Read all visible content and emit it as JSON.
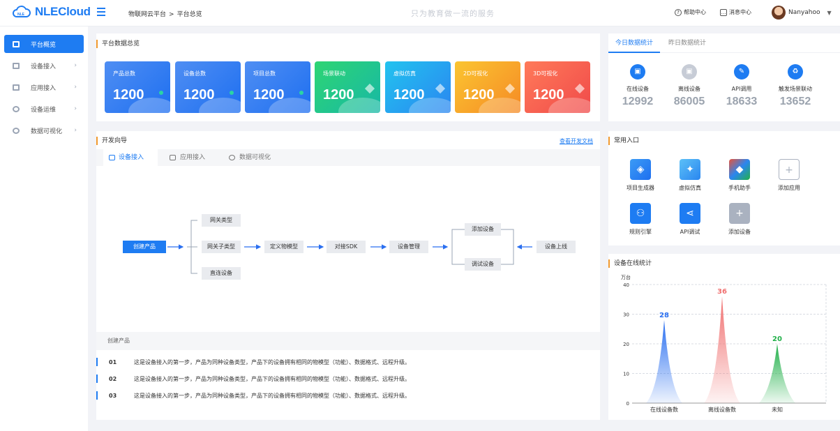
{
  "header": {
    "logo_text": "NLECloud",
    "breadcrumb": [
      "物联网云平台",
      "平台总览"
    ],
    "breadcrumb_sep": ">",
    "slogan": "只为教育做一流的服务",
    "help_label": "帮助中心",
    "message_label": "消息中心",
    "username": "Nanyahoo"
  },
  "sidebar": {
    "items": [
      {
        "label": "平台概览",
        "active": true
      },
      {
        "label": "设备接入"
      },
      {
        "label": "应用接入"
      },
      {
        "label": "设备运维"
      },
      {
        "label": "数据可视化"
      }
    ]
  },
  "overview": {
    "title": "平台数据总览",
    "tiles": [
      {
        "label": "产品总数",
        "value": "1200",
        "colors": [
          "#4f8ef3",
          "#1e6ff0"
        ]
      },
      {
        "label": "设备总数",
        "value": "1200",
        "colors": [
          "#4f8ef3",
          "#1e6ff0"
        ]
      },
      {
        "label": "项目总数",
        "value": "1200",
        "colors": [
          "#4f8ef3",
          "#1e6ff0"
        ]
      },
      {
        "label": "场景联动",
        "value": "1200",
        "colors": [
          "#2ed573",
          "#17b8a6"
        ]
      },
      {
        "label": "虚拟仿真",
        "value": "1200",
        "colors": [
          "#22c3ef",
          "#2a86f0"
        ]
      },
      {
        "label": "2D可视化",
        "value": "1200",
        "colors": [
          "#fbc531",
          "#f58a25"
        ]
      },
      {
        "label": "3D可视化",
        "value": "1200",
        "colors": [
          "#ff7a59",
          "#f04a4a"
        ]
      }
    ]
  },
  "today": {
    "tabs": [
      "今日数据统计",
      "昨日数据统计"
    ],
    "stats": [
      {
        "label": "在线设备",
        "value": "12992",
        "icon": "monitor-icon"
      },
      {
        "label": "离线设备",
        "value": "86005",
        "icon": "monitor-off-icon"
      },
      {
        "label": "API调用",
        "value": "18633",
        "icon": "api-icon"
      },
      {
        "label": "触发场景联动",
        "value": "13652",
        "icon": "recycle-icon"
      }
    ]
  },
  "guide": {
    "title": "开发向导",
    "doc_link": "查看开发文档",
    "tabs": [
      "设备接入",
      "应用接入",
      "数据可视化"
    ],
    "flow": {
      "create": "创建产品",
      "gateway": "网关类型",
      "gateway_sub": "网关子类型",
      "direct": "直连设备",
      "model": "定义物模型",
      "sdk": "对接SDK",
      "manage": "设备管理",
      "add": "添加设备",
      "debug": "调试设备",
      "online": "设备上线"
    },
    "steps_title": "创建产品",
    "steps": [
      {
        "num": "01",
        "text": "这是设备接入的第一步，产品为同种设备类型，产品下的设备拥有相同的物模型（功能）、数据格式、远程升级。"
      },
      {
        "num": "02",
        "text": "这是设备接入的第一步，产品为同种设备类型，产品下的设备拥有相同的物模型（功能）、数据格式、远程升级。"
      },
      {
        "num": "03",
        "text": "这是设备接入的第一步，产品为同种设备类型，产品下的设备拥有相同的物模型（功能）、数据格式、远程升级。"
      }
    ]
  },
  "entries": {
    "title": "常用入口",
    "items": [
      {
        "label": "项目生成器",
        "icon": "cube-icon",
        "color": "#1e7cf2"
      },
      {
        "label": "虚拟仿真",
        "icon": "network-icon",
        "color": "#2a9df4"
      },
      {
        "label": "手机助手",
        "icon": "gem-icon",
        "color": "#e8543b"
      },
      {
        "label": "添加应用",
        "icon": "plus-icon",
        "color": "#ffffff"
      },
      {
        "label": "规则引擎",
        "icon": "nodes-icon",
        "color": "#1e7cf2"
      },
      {
        "label": "API调试",
        "icon": "share-icon",
        "color": "#1e7cf2"
      },
      {
        "label": "添加设备",
        "icon": "plus-icon",
        "color": "#aab2c0"
      }
    ]
  },
  "online_chart": {
    "title": "设备在线统计",
    "unit": "万台"
  },
  "chart_data": {
    "type": "bar",
    "categories": [
      "在线设备数",
      "离线设备数",
      "未知"
    ],
    "values": [
      28,
      36,
      20
    ],
    "ylim": [
      0,
      40
    ],
    "yticks": [
      "0",
      "10",
      "20",
      "30",
      "40"
    ],
    "colors": [
      "#2a6ff0",
      "#f07070",
      "#22b04a"
    ],
    "grid": true
  }
}
